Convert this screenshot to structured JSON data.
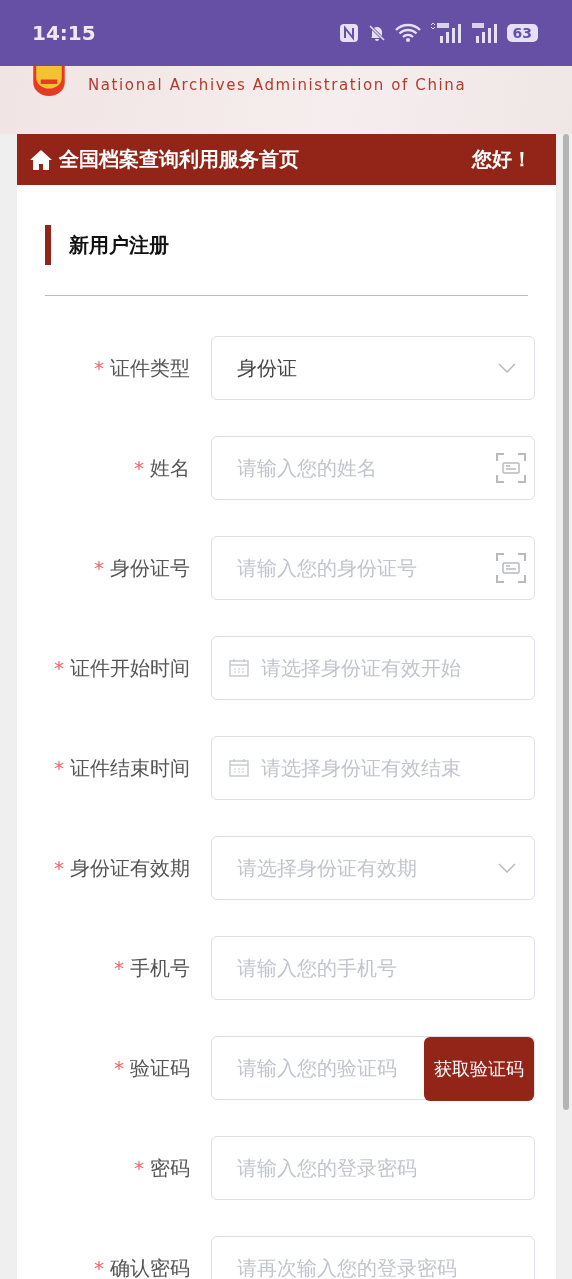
{
  "status_bar": {
    "time": "14:15",
    "battery": "63"
  },
  "banner": {
    "subtitle": "National Archives Administration of China"
  },
  "nav": {
    "home_label": "全国档案查询利用服务首页",
    "greeting": "您好！"
  },
  "section": {
    "title": "新用户注册"
  },
  "fields": [
    {
      "kind": "select",
      "label": "证件类型",
      "marker": "*",
      "value": "身份证"
    },
    {
      "kind": "idcard",
      "label": "姓名",
      "marker": "*",
      "placeholder": "请输入您的姓名"
    },
    {
      "kind": "idcard",
      "label": "身份证号",
      "marker": "*",
      "placeholder": "请输入您的身份证号"
    },
    {
      "kind": "date",
      "label": "证件开始时间",
      "marker": "*",
      "placeholder": "请选择身份证有效开始"
    },
    {
      "kind": "date",
      "label": "证件结束时间",
      "marker": "*",
      "placeholder": "请选择身份证有效结束"
    },
    {
      "kind": "select",
      "label": "身份证有效期",
      "marker": "*",
      "placeholder": "请选择身份证有效期"
    },
    {
      "kind": "text",
      "label": "手机号",
      "marker": "*",
      "placeholder": "请输入您的手机号"
    },
    {
      "kind": "code",
      "label": "验证码",
      "marker": "*",
      "placeholder": "请输入您的验证码",
      "button": "获取验证码"
    },
    {
      "kind": "text",
      "label": "密码",
      "marker": "*",
      "placeholder": "请输入您的登录密码"
    },
    {
      "kind": "text",
      "label": "确认密码",
      "marker": "*",
      "placeholder": "请再次输入您的登录密码"
    }
  ]
}
